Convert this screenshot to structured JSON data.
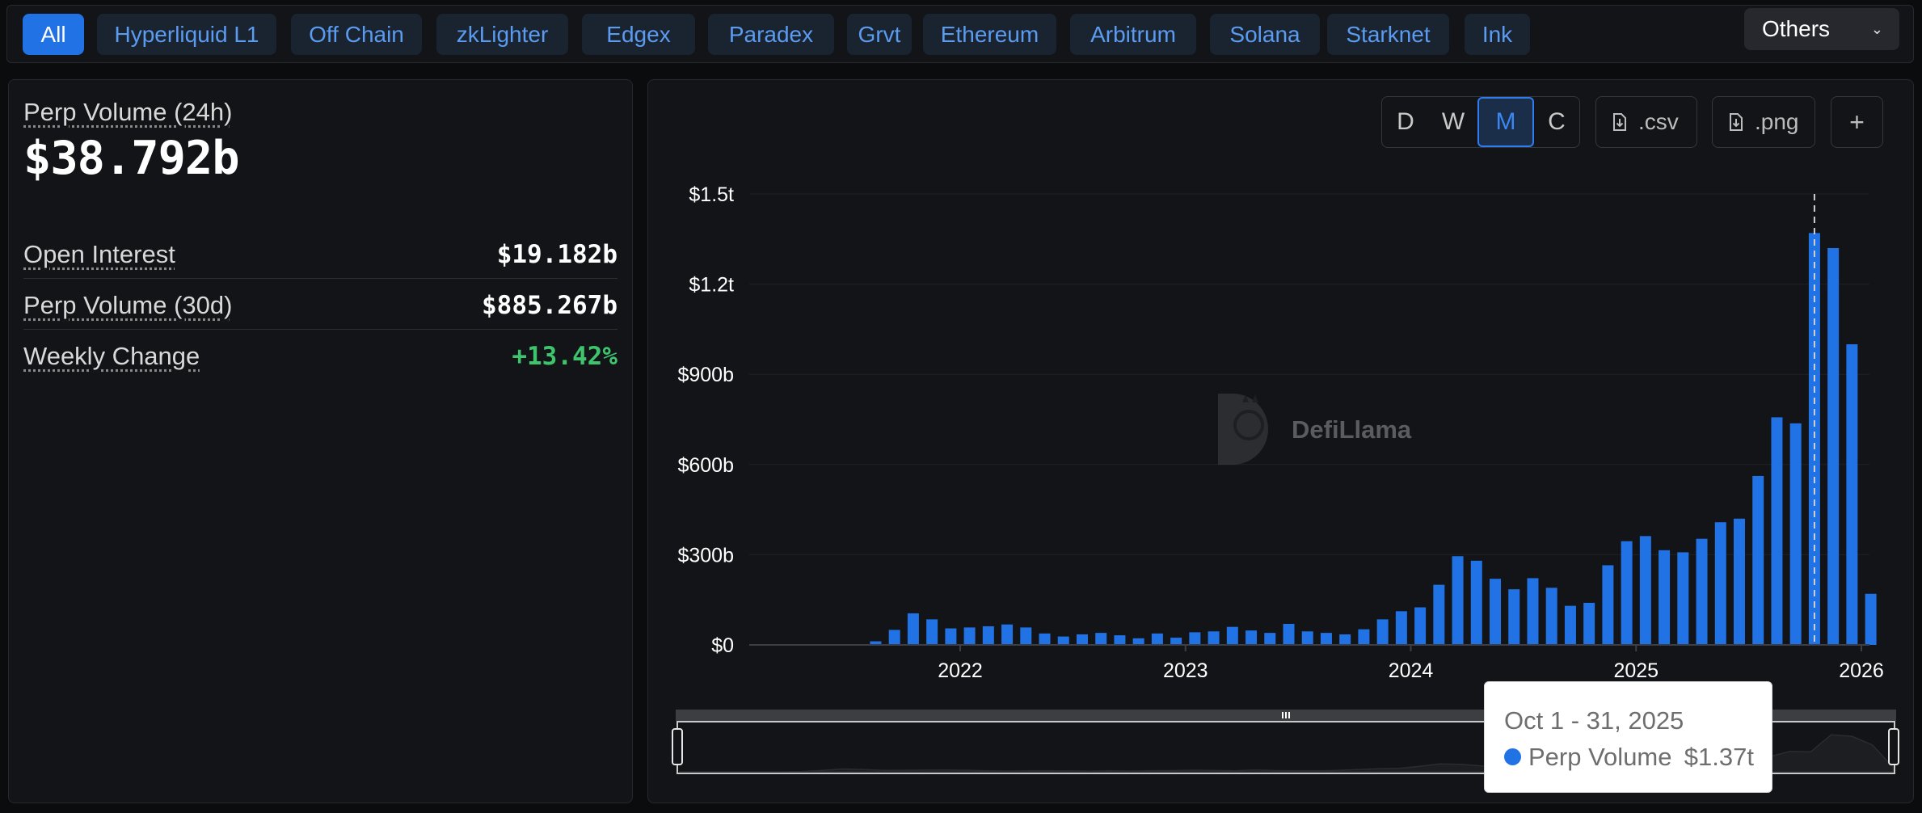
{
  "filters": {
    "chips": [
      "All",
      "Hyperliquid L1",
      "Off Chain",
      "zkLighter",
      "Edgex",
      "Paradex",
      "Grvt",
      "Ethereum",
      "Arbitrum",
      "Solana",
      "Starknet",
      "Ink"
    ],
    "active": "All",
    "others_label": "Others"
  },
  "stats": {
    "main_label": "Perp Volume (24h)",
    "main_value": "$38.792b",
    "rows": [
      {
        "label": "Open Interest",
        "value": "$19.182b"
      },
      {
        "label": "Perp Volume (30d)",
        "value": "$885.267b"
      },
      {
        "label": "Weekly Change",
        "value": "+13.42%"
      }
    ]
  },
  "toolbar": {
    "granularity": [
      "D",
      "W",
      "M",
      "C"
    ],
    "active_granularity": "M",
    "csv_label": ".csv",
    "png_label": ".png",
    "add_label": "+"
  },
  "watermark": "DefiLlama",
  "colors": {
    "bar": "#2172e5",
    "active_chip": "#2172e5",
    "positive": "#3ec46d",
    "background": "#0b0c0e",
    "panel": "#131417"
  },
  "chart_data": {
    "type": "bar",
    "title": "",
    "xlabel": "",
    "ylabel": "",
    "series": [
      {
        "values": [
          1,
          1,
          1,
          1,
          1,
          1,
          12,
          50,
          105,
          85,
          55,
          58,
          62,
          68,
          58,
          38,
          28,
          35,
          40,
          32,
          22,
          38,
          24,
          42,
          45,
          60,
          48,
          40,
          70,
          45,
          40,
          35,
          52,
          85,
          112,
          125,
          200,
          295,
          280,
          220,
          185,
          222,
          190,
          130,
          140,
          265,
          345,
          362,
          315,
          308,
          353,
          408,
          420,
          562,
          757,
          737,
          1370,
          1320,
          1000,
          170
        ]
      }
    ],
    "categories": [
      "2021-02",
      "2021-03",
      "2021-04",
      "2021-05",
      "2021-06",
      "2021-07",
      "2021-08",
      "2021-09",
      "2021-10",
      "2021-11",
      "2021-12",
      "2022-01",
      "2022-02",
      "2022-03",
      "2022-04",
      "2022-05",
      "2022-06",
      "2022-07",
      "2022-08",
      "2022-09",
      "2022-10",
      "2022-11",
      "2022-12",
      "2023-01",
      "2023-02",
      "2023-03",
      "2023-04",
      "2023-05",
      "2023-06",
      "2023-07",
      "2023-08",
      "2023-09",
      "2023-10",
      "2023-11",
      "2023-12",
      "2024-01",
      "2024-02",
      "2024-03",
      "2024-04",
      "2024-05",
      "2024-06",
      "2024-07",
      "2024-08",
      "2024-09",
      "2024-10",
      "2024-11",
      "2024-12",
      "2025-01",
      "2025-02",
      "2025-03",
      "2025-04",
      "2025-05",
      "2025-06",
      "2025-07",
      "2025-08",
      "2025-09",
      "2025-10",
      "2025-11",
      "2025-12",
      "2026-01"
    ],
    "y_unit": "billions USD",
    "y_tick_labels": [
      "$0",
      "$300b",
      "$600b",
      "$900b",
      "$1.2t",
      "$1.5t"
    ],
    "y_tick_values": [
      0,
      300,
      600,
      900,
      1200,
      1500
    ],
    "ylim": [
      0,
      1500
    ],
    "x_tick_labels": [
      "2022",
      "2023",
      "2024",
      "2025",
      "2026"
    ],
    "legend": "none",
    "grid": "horizontal"
  },
  "tooltip": {
    "date": "Oct 1 - 31, 2025",
    "series": "Perp Volume",
    "value": "$1.37t"
  }
}
